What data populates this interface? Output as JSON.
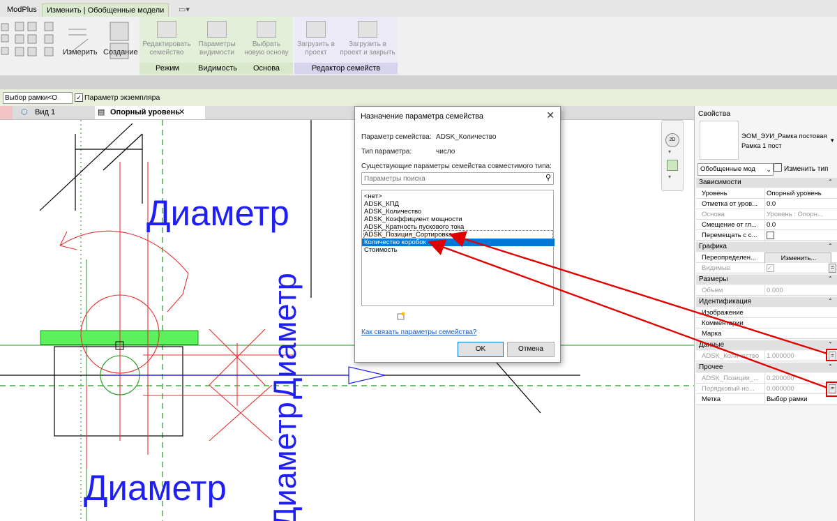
{
  "ribbon": {
    "tabs": [
      "ModPlus",
      "Изменить | Обобщенные модели"
    ],
    "panels": {
      "measure": "Измерить",
      "create": "Создание",
      "mode": "Режим",
      "visibility": "Видимость",
      "basis": "Основа",
      "family_editor": "Редактор семейств"
    },
    "buttons": {
      "edit_family": [
        "Редактировать",
        "семейство"
      ],
      "visibility_params": [
        "Параметры",
        "видимости"
      ],
      "select_host": [
        "Выбрать",
        "новую основу"
      ],
      "load_into_project": [
        "Загрузить в",
        "проект"
      ],
      "load_close": [
        "Загрузить в",
        "проект и закрыть"
      ]
    }
  },
  "options_bar": {
    "select_value": "Выбор рамки<О",
    "instance_param_label": "Параметр экземпляра",
    "instance_param_checked": true
  },
  "view_tabs": [
    {
      "label": "Вид 1"
    },
    {
      "label": "Опорный уровень",
      "close": "✕"
    }
  ],
  "canvas": {
    "labels": [
      "Диаметр",
      "Диаметр",
      "Диаметр",
      "Диаметр"
    ]
  },
  "dialog": {
    "title": "Назначение параметра семейства",
    "close": "✕",
    "family_param_label": "Параметр семейства:",
    "family_param_value": "ADSK_Количество",
    "param_type_label": "Тип параметра:",
    "param_type_value": "число",
    "existing_label": "Существующие параметры семейства совместимого типа:",
    "search_placeholder": "Параметры поиска",
    "items": [
      "<нет>",
      "ADSK_КПД",
      "ADSK_Количество",
      "ADSK_Коэффициент мощности",
      "ADSK_Кратность пускового тока",
      "ADSK_Позиция_Сортировка",
      "Количество коробок",
      "Стоимость"
    ],
    "selected_index": 6,
    "link": "Как связать параметры семейства?",
    "ok": "OK",
    "cancel": "Отмена"
  },
  "properties": {
    "title": "Свойства",
    "type_name_1": "ЭОМ_ЭУИ_Рамка постовая",
    "type_name_2": "Рамка 1 пост",
    "type_selector": "Обобщенные мод",
    "edit_type": "Изменить тип",
    "groups": {
      "constraints": "Зависимости",
      "graphics": "Графика",
      "dimensions": "Размеры",
      "identity": "Идентификация",
      "data": "Данные",
      "other": "Прочее"
    },
    "rows": {
      "level": {
        "name": "Уровень",
        "value": "Опорный уровень"
      },
      "elevation": {
        "name": "Отметка от уров...",
        "value": "0.0"
      },
      "host": {
        "name": "Основа",
        "value": "Уровень : Опорн..."
      },
      "offset": {
        "name": "Смещение от гл...",
        "value": "0.0"
      },
      "move_with": {
        "name": "Перемещать с с..."
      },
      "override": {
        "name": "Переопределен...",
        "value": "Изменить..."
      },
      "visible": {
        "name": "Видимые"
      },
      "volume": {
        "name": "Объем",
        "value": "0.000"
      },
      "image": {
        "name": "Изображение"
      },
      "comments": {
        "name": "Комментарии"
      },
      "mark": {
        "name": "Марка"
      },
      "adsk_qty": {
        "name": "ADSK_Количество",
        "value": "1.000000"
      },
      "adsk_pos": {
        "name": "ADSK_Позиция_...",
        "value": "0.200000"
      },
      "seq_no": {
        "name": "Порядковый но...",
        "value": "0.000000"
      },
      "label": {
        "name": "Метка",
        "value": "Выбор рамки"
      }
    }
  },
  "colors": {
    "accent_red": "#e00000",
    "text_blue": "#1f1ff5",
    "selection": "#0078d7"
  }
}
